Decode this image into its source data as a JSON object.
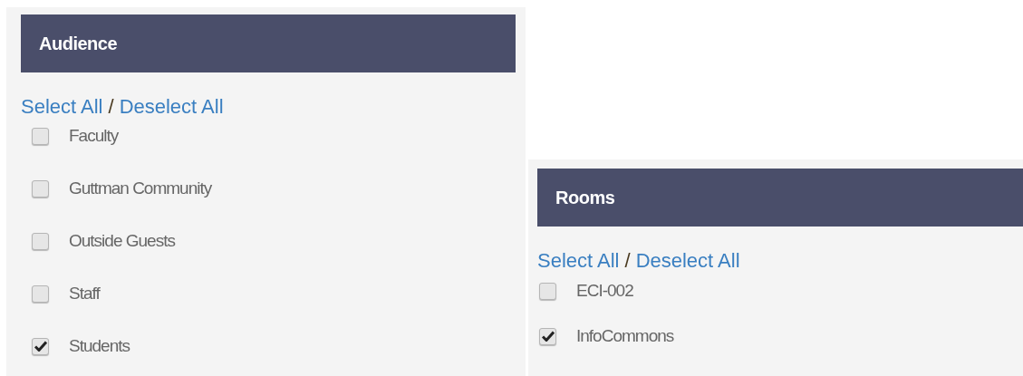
{
  "panels": [
    {
      "title": "Audience",
      "select_all": "Select All",
      "separator": "/",
      "deselect_all": "Deselect All",
      "items": [
        {
          "label": "Faculty",
          "checked": false
        },
        {
          "label": "Guttman Community",
          "checked": false
        },
        {
          "label": "Outside Guests",
          "checked": false
        },
        {
          "label": "Staff",
          "checked": false
        },
        {
          "label": "Students",
          "checked": true
        }
      ]
    },
    {
      "title": "Rooms",
      "select_all": "Select All",
      "separator": "/",
      "deselect_all": "Deselect All",
      "items": [
        {
          "label": "ECI-002",
          "checked": false
        },
        {
          "label": "InfoCommons",
          "checked": true
        }
      ]
    }
  ]
}
